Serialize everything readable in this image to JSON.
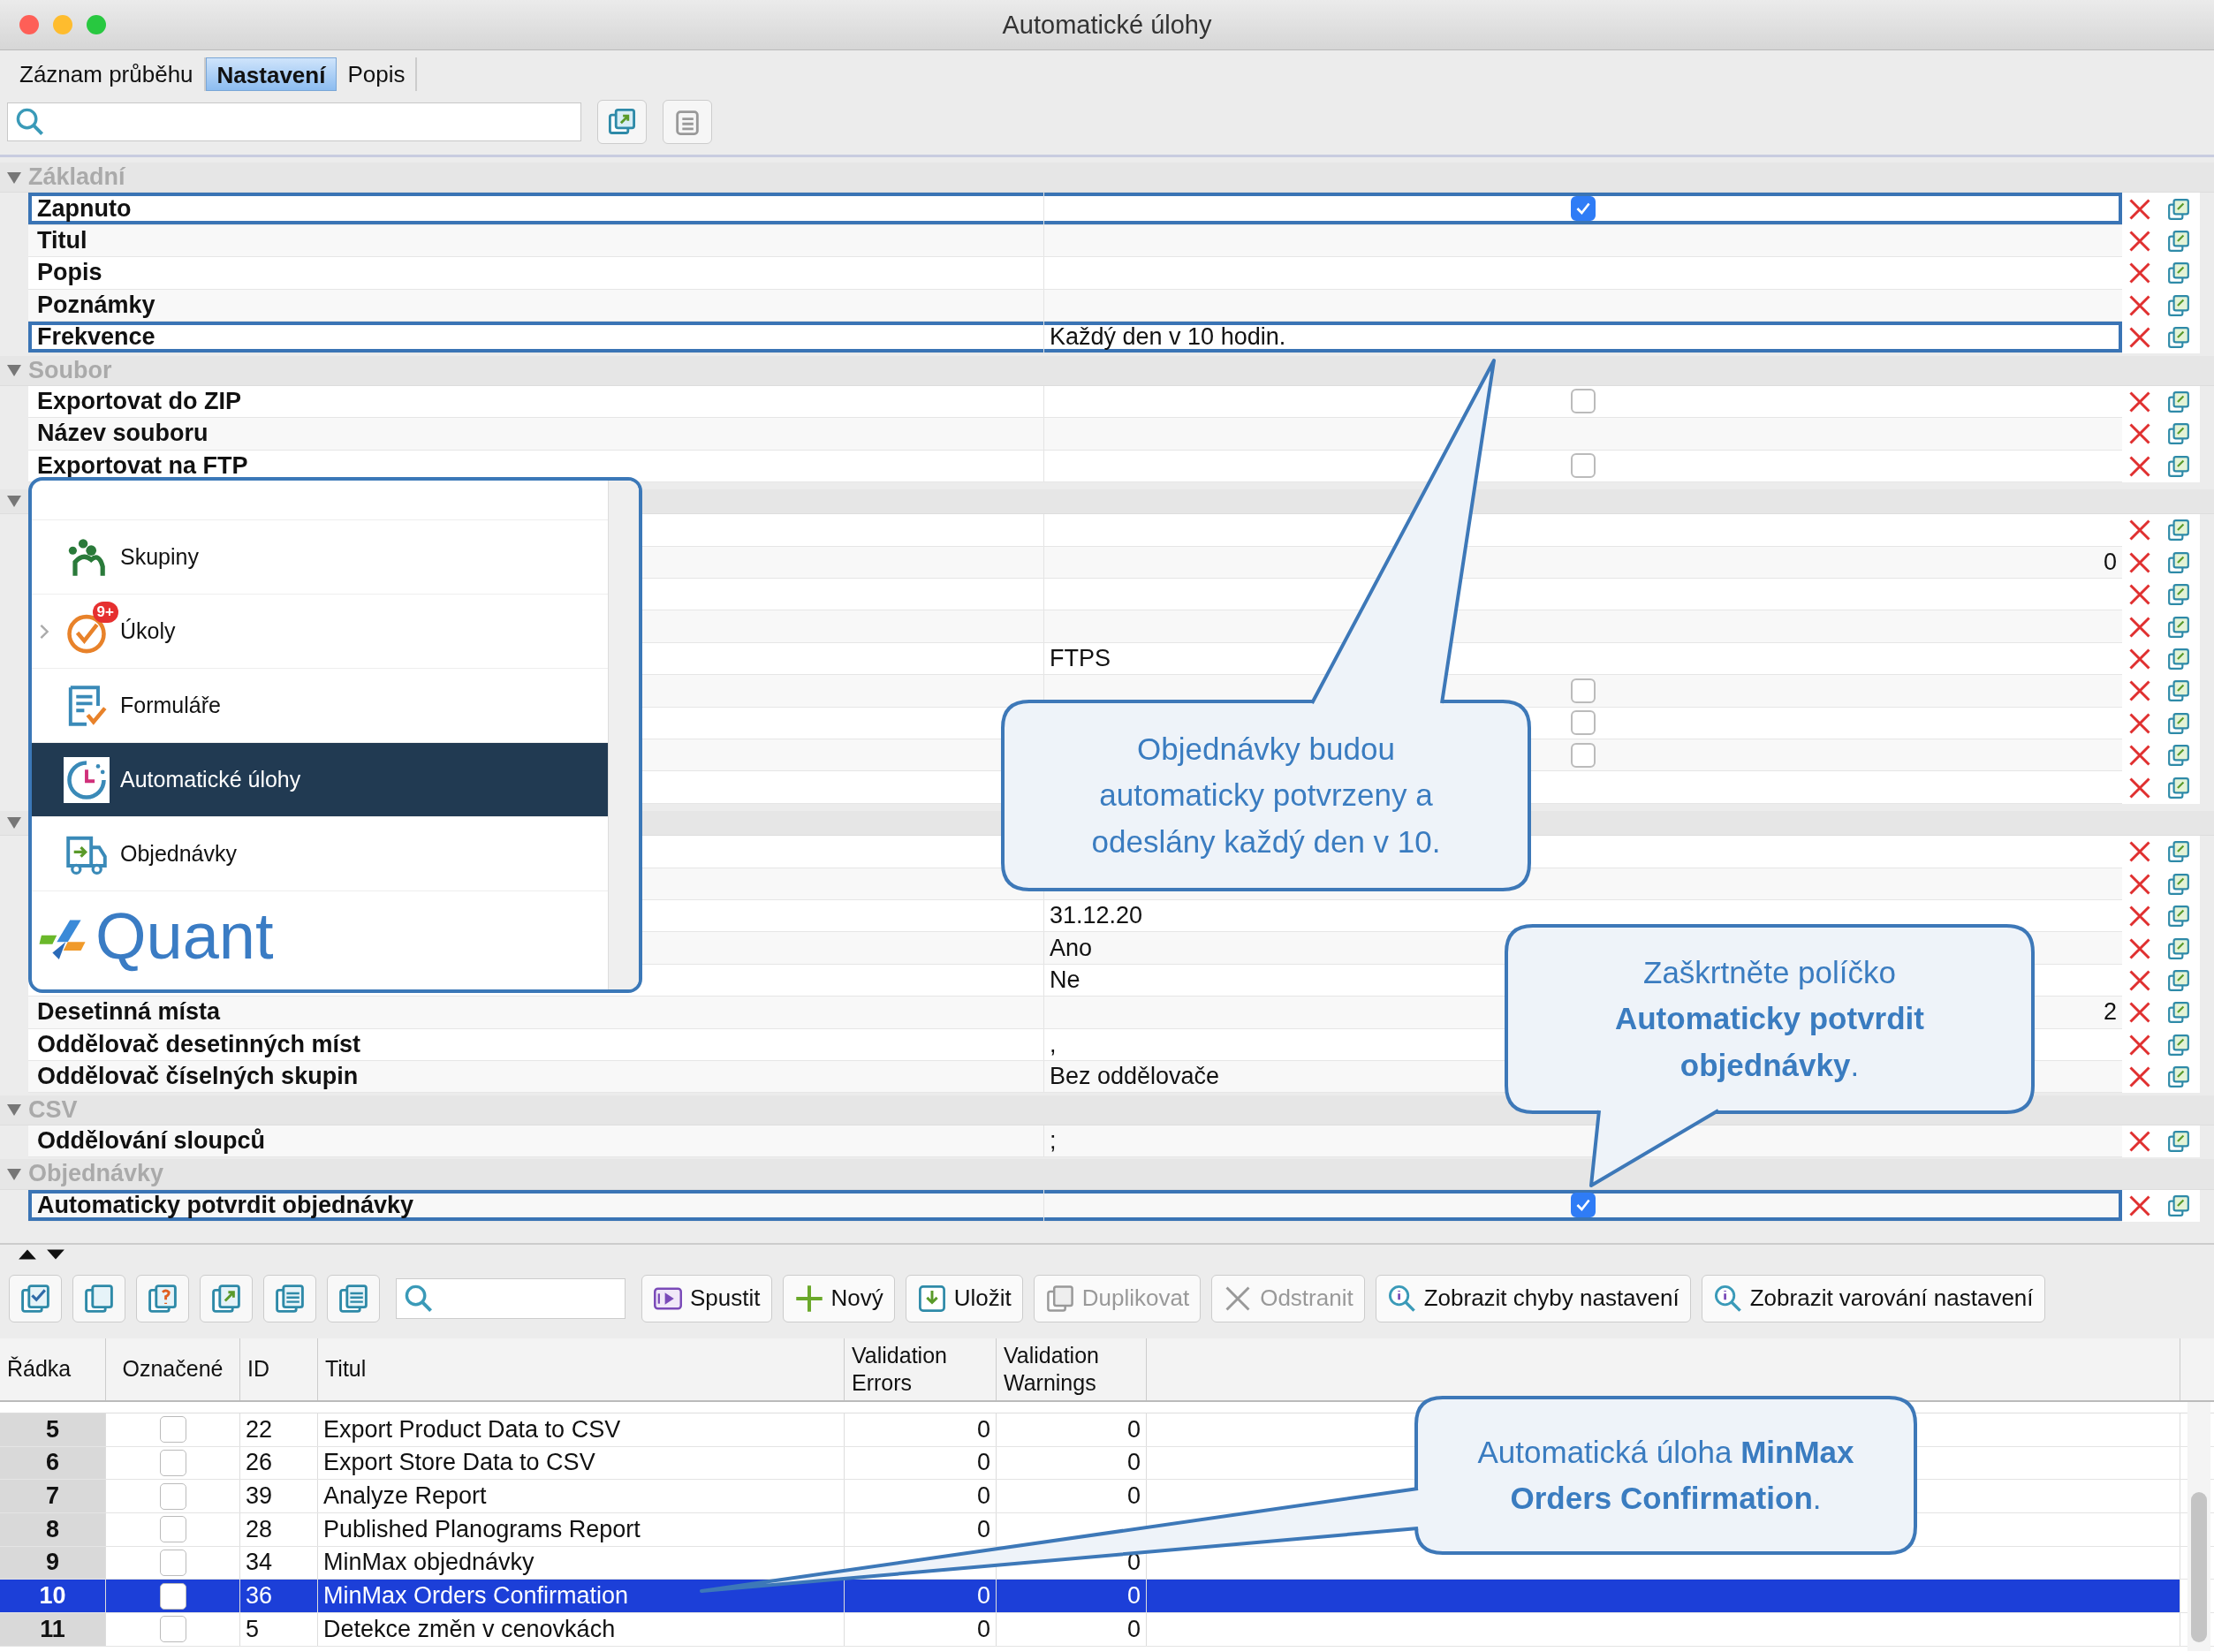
{
  "window": {
    "title": "Automatické úlohy"
  },
  "tabs": [
    {
      "label": "Záznam průběhu",
      "selected": false
    },
    {
      "label": "Nastavení",
      "selected": true
    },
    {
      "label": "Popis",
      "selected": false
    }
  ],
  "property_grid": {
    "rows": [
      {
        "kind": "header",
        "label": "Základní",
        "expanded": true
      },
      {
        "kind": "check",
        "label": "Zapnuto",
        "checked": true,
        "outlined": true
      },
      {
        "kind": "text",
        "label": "Titul",
        "outlined": false
      },
      {
        "kind": "text",
        "label": "Popis",
        "outlined": false
      },
      {
        "kind": "text",
        "label": "Poznámky",
        "outlined": false
      },
      {
        "kind": "text",
        "label": "Frekvence",
        "value": "Každý den v 10 hodin.",
        "outlined": true
      },
      {
        "kind": "header",
        "label": "Soubor",
        "expanded": true
      },
      {
        "kind": "check",
        "label": "Exportovat do ZIP",
        "checked": false,
        "outlined": false
      },
      {
        "kind": "text",
        "label": "Název souboru",
        "outlined": false
      },
      {
        "kind": "check",
        "label": "Exportovat na FTP",
        "checked": false,
        "outlined": false
      },
      {
        "kind": "header",
        "expanded": true
      },
      {
        "kind": "text",
        "outlined": false
      },
      {
        "kind": "number",
        "value": "0",
        "outlined": false
      },
      {
        "kind": "text",
        "outlined": false
      },
      {
        "kind": "text",
        "outlined": false
      },
      {
        "kind": "text",
        "value": "FTPS",
        "outlined": false
      },
      {
        "kind": "check",
        "checked": false,
        "outlined": false
      },
      {
        "kind": "check",
        "checked": false,
        "outlined": false
      },
      {
        "kind": "check",
        "checked": false,
        "outlined": false
      },
      {
        "kind": "text",
        "outlined": false
      },
      {
        "kind": "header",
        "expanded": true
      },
      {
        "kind": "text",
        "outlined": false
      },
      {
        "kind": "text",
        "outlined": false
      },
      {
        "kind": "text",
        "value": "31.12.20",
        "outlined": false
      },
      {
        "kind": "text",
        "value": "Ano",
        "outlined": false
      },
      {
        "kind": "text",
        "value": "Ne",
        "outlined": false
      },
      {
        "kind": "number",
        "label": "Desetinná místa",
        "value": "2",
        "outlined": false
      },
      {
        "kind": "text",
        "label": "Oddělovač desetinných míst",
        "value": ",",
        "outlined": false
      },
      {
        "kind": "text",
        "label": "Oddělovač číselných skupin",
        "value": "Bez oddělovače",
        "outlined": false
      },
      {
        "kind": "header",
        "label": "CSV",
        "expanded": true
      },
      {
        "kind": "text",
        "label": "Oddělování sloupců",
        "value": ";",
        "outlined": false
      },
      {
        "kind": "header",
        "label": "Objednávky",
        "expanded": true
      },
      {
        "kind": "check",
        "label": "Automaticky potvrdit objednávky",
        "checked": true,
        "outlined": true
      }
    ]
  },
  "navigation_menu": {
    "items": [
      {
        "label": "Skupiny",
        "selected": false,
        "expandable": false
      },
      {
        "label": "Úkoly",
        "selected": false,
        "expandable": true,
        "badge": "9+"
      },
      {
        "label": "Formuláře",
        "selected": false,
        "expandable": false
      },
      {
        "label": "Automatické úlohy",
        "selected": true,
        "expandable": false
      },
      {
        "label": "Objednávky",
        "selected": false,
        "expandable": false
      }
    ],
    "logo": "Quant"
  },
  "toolbar": {
    "buttons": [
      {
        "label": "Spustit",
        "disabled": false
      },
      {
        "label": "Nový",
        "disabled": false
      },
      {
        "label": "Uložit",
        "disabled": false
      },
      {
        "label": "Duplikovat",
        "disabled": true
      },
      {
        "label": "Odstranit",
        "disabled": true
      },
      {
        "label": "Zobrazit chyby nastavení",
        "disabled": false
      },
      {
        "label": "Zobrazit varování nastavení",
        "disabled": false
      }
    ]
  },
  "table": {
    "columns": [
      "Řádka",
      "Označené",
      "ID",
      "Titul",
      "Validation Errors",
      "Validation Warnings"
    ],
    "rows": [
      {
        "row": "5",
        "marked": false,
        "id": "22",
        "title": "Export Product Data to CSV",
        "errors": "0",
        "warnings": "0",
        "selected": false
      },
      {
        "row": "6",
        "marked": false,
        "id": "26",
        "title": "Export Store Data to CSV",
        "errors": "0",
        "warnings": "0",
        "selected": false
      },
      {
        "row": "7",
        "marked": false,
        "id": "39",
        "title": "Analyze Report",
        "errors": "0",
        "warnings": "0",
        "selected": false
      },
      {
        "row": "8",
        "marked": false,
        "id": "28",
        "title": "Published Planograms Report",
        "errors": "0",
        "selected": false
      },
      {
        "row": "9",
        "marked": false,
        "id": "34",
        "title": "MinMax objednávky",
        "warnings": "0",
        "selected": false
      },
      {
        "row": "10",
        "marked": false,
        "id": "36",
        "title": "MinMax Orders Confirmation",
        "errors": "0",
        "warnings": "0",
        "selected": true
      },
      {
        "row": "11",
        "marked": false,
        "id": "5",
        "title": "Detekce změn v cenovkách",
        "errors": "0",
        "warnings": "0",
        "selected": false
      }
    ]
  },
  "callouts": [
    {
      "text": "Objednávky budou automaticky potvrzeny a odeslány každý den v 10."
    },
    {
      "text": "Zaškrtněte políčko **Automaticky potvrdit objednávky**."
    },
    {
      "text": "Automatická úloha **MinMax Orders Confirmation**."
    }
  ]
}
